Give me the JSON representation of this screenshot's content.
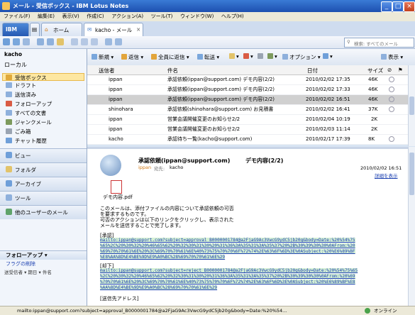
{
  "window": {
    "title": "メール - 受信ボックス - IBM Lotus Notes"
  },
  "menu": [
    "ファイル(F)",
    "編集(E)",
    "表示(V)",
    "作成(C)",
    "アクション(A)",
    "ツール(T)",
    "ウィンドウ(W)",
    "ヘルプ(H)"
  ],
  "tabs": {
    "home": "ホーム",
    "mail": "kacho - メール"
  },
  "search": {
    "placeholder": "検索: すべてのメール"
  },
  "nav": {
    "user": "kacho",
    "location": "ローカル",
    "items": [
      "受信ボックス",
      "ドラフト",
      "送信済み",
      "フォローアップ",
      "すべての文書",
      "ジャンクメール",
      "ごみ箱",
      "チャット履歴"
    ],
    "sections": [
      "ビュー",
      "フォルダ",
      "アーカイブ",
      "ツール",
      "他のユーザーのメール"
    ],
    "followup": {
      "title": "フォローアップ",
      "flag": "フラグの削除",
      "cols": [
        "送受信者",
        "期日",
        "件名"
      ]
    }
  },
  "actions": [
    "新規",
    "返信",
    "全員に返信",
    "転送",
    "オプション",
    "表示"
  ],
  "list": {
    "headers": {
      "sender": "送信者",
      "subject": "件名",
      "date": "日付",
      "size": "サイズ"
    },
    "rows": [
      {
        "sender": "ippan",
        "subject": "承認依頼(ippan@support.com) デモ内容(2/2)",
        "date": "2010/02/02 17:35",
        "size": "46K",
        "selected": false
      },
      {
        "sender": "ippan",
        "subject": "承認依頼(ippan@support.com) デモ内容(2/2)",
        "date": "2010/02/02 17:33",
        "size": "46K",
        "selected": false
      },
      {
        "sender": "ippan",
        "subject": "承認依頼(ippan@support.com) デモ内容(2/2)",
        "date": "2010/02/02 16:51",
        "size": "46K",
        "selected": true
      },
      {
        "sender": "shinohara",
        "subject": "承認依頼(shinohara@support.com) お見積書",
        "date": "2010/02/02 16:41",
        "size": "37K",
        "selected": false
      },
      {
        "sender": "ippan",
        "subject": "営業会議開催変更のお知らせ2/2",
        "date": "2010/02/04 10:19",
        "size": "2K",
        "selected": false
      },
      {
        "sender": "ippan",
        "subject": "営業会議開催変更のお知らせ2/2",
        "date": "2010/02/03 11:14",
        "size": "2K",
        "selected": false
      },
      {
        "sender": "kacho",
        "subject": "承認待ち一覧(kacho@support.com)",
        "date": "2010/02/17 17:39",
        "size": "8K",
        "selected": false
      }
    ]
  },
  "preview": {
    "subject": "承認依頼(ippan@support.com)",
    "subject2": "デモ内容(2/2)",
    "from": "ippan",
    "to_label": "宛先:",
    "to": "kacho",
    "date": "2010/02/02 16:51",
    "details": "詳細を表示",
    "attachment": "デモ内容.pdf",
    "body": [
      "このメールは、添付ファイルの内容について承認依頼の可否",
      "を要求するものです。",
      "可否のアクションは以下のリンクをクリックし、表示された",
      "メールを送信することで完了します。"
    ],
    "approve_label": "[承認]",
    "approve_link": [
      "mailto:ippan@support.com?subject=approval_B0000001784@a2FjaG9Ac3VwcG9ydC5jb20g&body=Date:%20%54%75",
      "%65%2C%20%30%32%20%46%65%62%20%32%30%31%30%20%31%36%3A%35%31%3A%35%37%20%2B%30%39%30%30%0AFrom:%20",
      "%69%70%70%61%6E%20%3C%69%70%70%61%6E%40%73%75%70%70%6F%72%74%2E%63%6F%6D%3E%0ASubject:%20%E6%89%BF",
      "%E8%AA%8D%E4%BE%9D%E9%A0%BC%28%69%70%70%61%6E%29"
    ],
    "reject_label": "[却下]",
    "reject_link": [
      "mailto:ippan@support.com?subject=reject_B0000001784@a2FjaG9Ac3VwcG9ydC5jb20g&body=Date:%20%54%75%65",
      "%2C%20%30%32%20%46%65%62%20%32%30%31%30%20%31%36%3A%35%31%3A%35%37%20%2B%30%39%30%30%0AFrom:%20%69",
      "%70%70%61%6E%20%3C%69%70%70%61%6E%40%73%75%70%70%6F%72%74%2E%63%6F%6D%3E%0ASubject:%20%E6%89%BF%E8",
      "%AA%8D%E4%BE%9D%E9%A0%BC%28%69%70%70%61%6E%29"
    ],
    "trailing": "[送信先アドレス]"
  },
  "status": {
    "text": "mailto:ippan@support.com?subject=approval_B0000001784@a2FjaG9Ac3VwcG9ydC5jb20g&body=Date:%20%54...",
    "online": "オンライン"
  },
  "colors": {
    "title_bar": "#1d4fb0",
    "selected_item": "#fde7a2",
    "link": "#1a3fb0"
  }
}
